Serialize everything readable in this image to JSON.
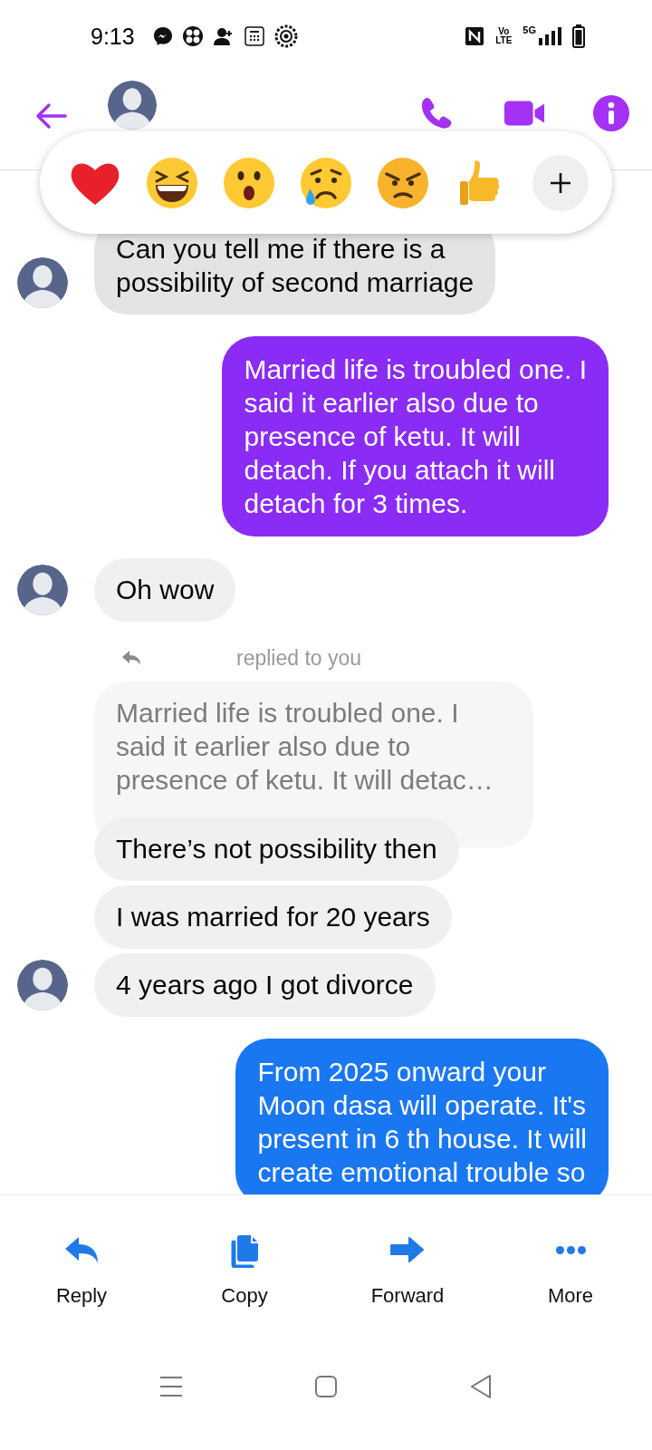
{
  "status_bar": {
    "time": "9:13",
    "volte_top": "Vo",
    "volte_bottom": "LTE",
    "network_type": "5G"
  },
  "reactions": [
    {
      "kind": "heart"
    },
    {
      "kind": "laughing"
    },
    {
      "kind": "surprised"
    },
    {
      "kind": "crying"
    },
    {
      "kind": "angry"
    },
    {
      "kind": "thumbs_up"
    },
    {
      "kind": "more"
    }
  ],
  "messages": [
    {
      "kind": "incoming",
      "text": "Can you tell me if there is a\npossibility of second marriage",
      "avatar": true,
      "selected": true
    },
    {
      "kind": "outgoing",
      "text": "Married life is troubled one. I\nsaid it earlier also due to\npresence of ketu. It will\ndetach. If you attach it will\ndetach for 3 times.",
      "color": "#8a2cf5",
      "selected": false
    },
    {
      "kind": "incoming",
      "text": "Oh wow",
      "avatar": true,
      "selected": false
    },
    {
      "kind": "reply_label",
      "text": "replied to you"
    },
    {
      "kind": "quoted",
      "text": "Married life is troubled one. I\nsaid it earlier also due to\npresence of ketu. It will detac…"
    },
    {
      "kind": "incoming",
      "text": "There’s not possibility then",
      "avatar": false,
      "selected": false
    },
    {
      "kind": "incoming",
      "text": "I was married for 20 years",
      "avatar": false,
      "selected": false
    },
    {
      "kind": "incoming",
      "text": "4 years ago I got divorce",
      "avatar": true,
      "selected": false
    },
    {
      "kind": "outgoing",
      "text": "From 2025 onward your\nMoon dasa will operate. It's\npresent in 6 th house. It will\ncreate emotional trouble so",
      "color": "#1a77f2",
      "selected": false
    }
  ],
  "actions": [
    {
      "kind": "reply",
      "label": "Reply"
    },
    {
      "kind": "copy",
      "label": "Copy"
    },
    {
      "kind": "forward",
      "label": "Forward"
    },
    {
      "kind": "more",
      "label": "More"
    }
  ]
}
